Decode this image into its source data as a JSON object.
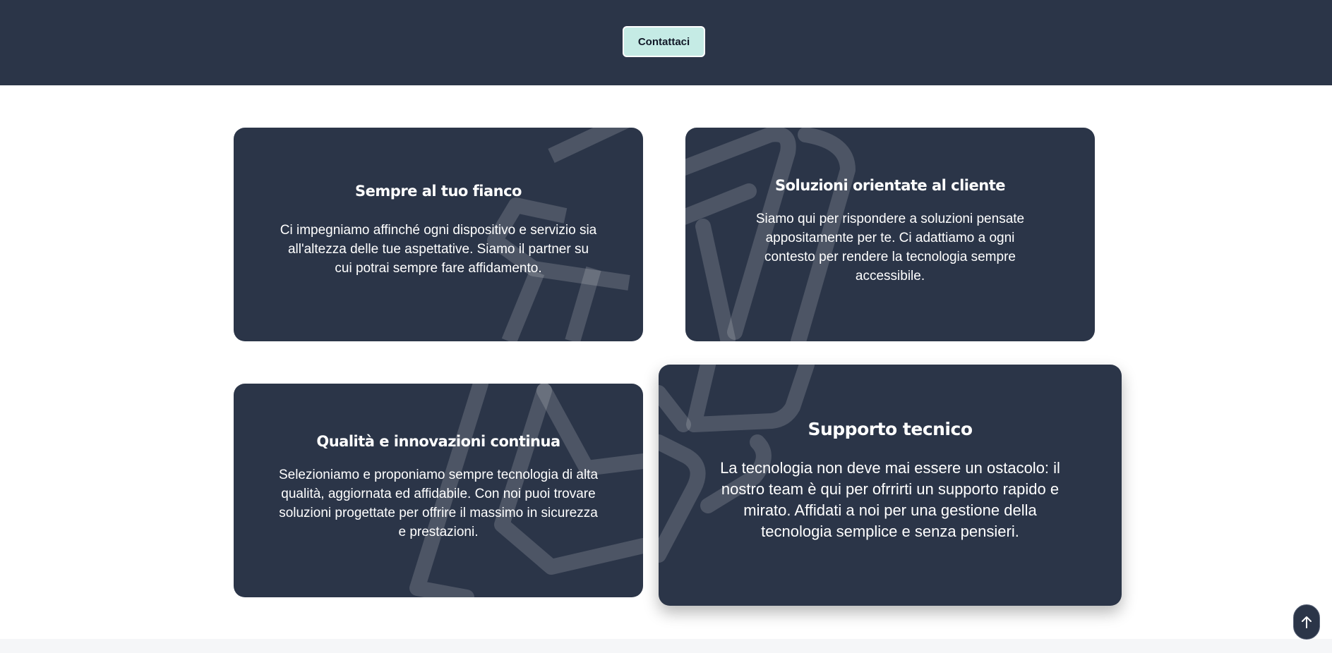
{
  "header": {
    "contact_label": "Contattaci"
  },
  "cards": [
    {
      "title": "Sempre al tuo fianco",
      "text": "Ci impegniamo affinché ogni dispositivo e servizio sia all'altezza delle tue aspettative. Siamo il partner su cui potrai sempre fare affidamento."
    },
    {
      "title": "Soluzioni orientate al cliente",
      "text": "Siamo qui per rispondere a soluzioni pensate appositamente per te. Ci adattiamo a ogni contesto per rendere la tecnologia sempre accessibile."
    },
    {
      "title": "Qualità e innovazioni continua",
      "text": "Selezioniamo e proponiamo sempre tecnologia di alta qualità, aggiornata ed affidabile. Con noi puoi trovare soluzioni progettate per offrire il massimo in sicurezza e prestazioni."
    },
    {
      "title": "Supporto tecnico",
      "text": "La tecnologia non deve mai essere un ostacolo: il nostro team è qui per ofrrirti un supporto rapido e mirato. Affidati a noi per una gestione della tecnologia semplice e senza pensieri."
    }
  ],
  "scroll_top": {
    "icon": "arrow-up-icon"
  },
  "colors": {
    "navy": "#2b3548",
    "accent": "#c5ebe5",
    "watermark": "#ffffff"
  }
}
